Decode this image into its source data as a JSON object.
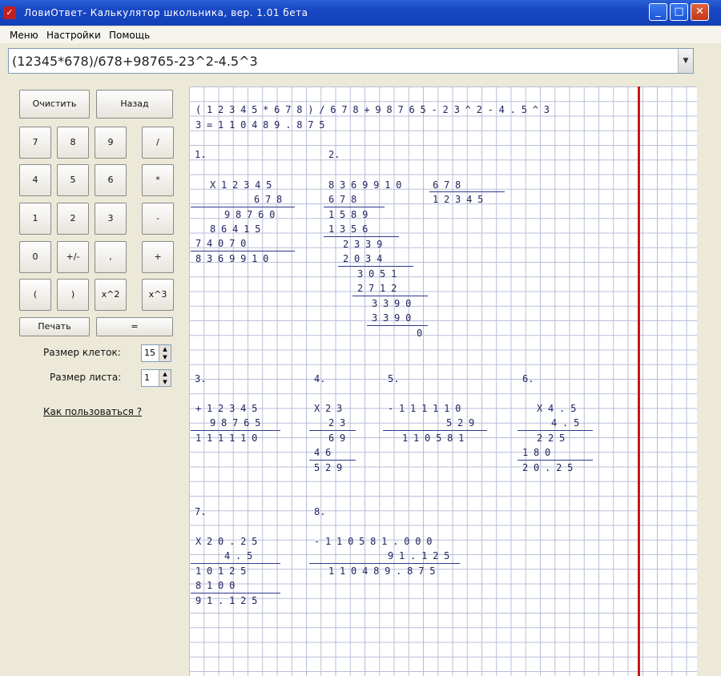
{
  "window": {
    "title": "ЛовиОтвет- Калькулятор школьника, вер.  1.01 бета"
  },
  "menu": [
    "Меню",
    "Настройки",
    "Помощь"
  ],
  "expression": "(12345*678)/678+98765-23^2-4.5^3",
  "buttons": {
    "clear": "Очистить",
    "back": "Назад",
    "seven": "7",
    "eight": "8",
    "nine": "9",
    "div": "/",
    "four": "4",
    "five": "5",
    "six": "6",
    "mul": "*",
    "one": "1",
    "two": "2",
    "three": "3",
    "minus": "-",
    "zero": "0",
    "plusminus": "+/-",
    "comma": ",",
    "plus": "+",
    "lparen": "(",
    "rparen": ")",
    "sq": "x^2",
    "cube": "x^3",
    "print": "Печать",
    "equals": "="
  },
  "settings": {
    "cell_size_label": "Размер клеток:",
    "cell_size_value": "15",
    "sheet_size_label": "Размер листа:",
    "sheet_size_value": "1",
    "howto_link": "Как пользоваться ?"
  },
  "sheet": {
    "expr_line": "(12345*678)/678+98765-23^2-4.5^3",
    "result_line": "3=110489.875",
    "step_labels": [
      "1.",
      "2.",
      "3.",
      "4.",
      "5.",
      "6.",
      "7.",
      "8."
    ],
    "step1": [
      "X12345",
      "678",
      "98760",
      "86415",
      "74070",
      "8369910"
    ],
    "step2": [
      "8369910",
      "678",
      "12345",
      "678",
      "1589",
      "1356",
      "2339",
      "2034",
      "3051",
      "2712",
      "3390",
      "3390",
      "0"
    ],
    "step3": [
      "+12345",
      "98765",
      "111110"
    ],
    "step4": [
      "X23",
      "23",
      "69",
      "46",
      "529"
    ],
    "step5": [
      "-111110",
      "529",
      "110581"
    ],
    "step6": [
      "X4.5",
      "4.5",
      "225",
      "180",
      "20.25"
    ],
    "step7": [
      "X20.25",
      "4.5",
      "10125",
      "8100",
      "91.125"
    ],
    "step8": [
      "-110581.000",
      "91.125",
      "110489.875"
    ]
  },
  "colors": {
    "grid_line": "#b8bed8",
    "margin_line": "#c81818",
    "digits": "#23235f",
    "titlebar": "#1847c4"
  }
}
